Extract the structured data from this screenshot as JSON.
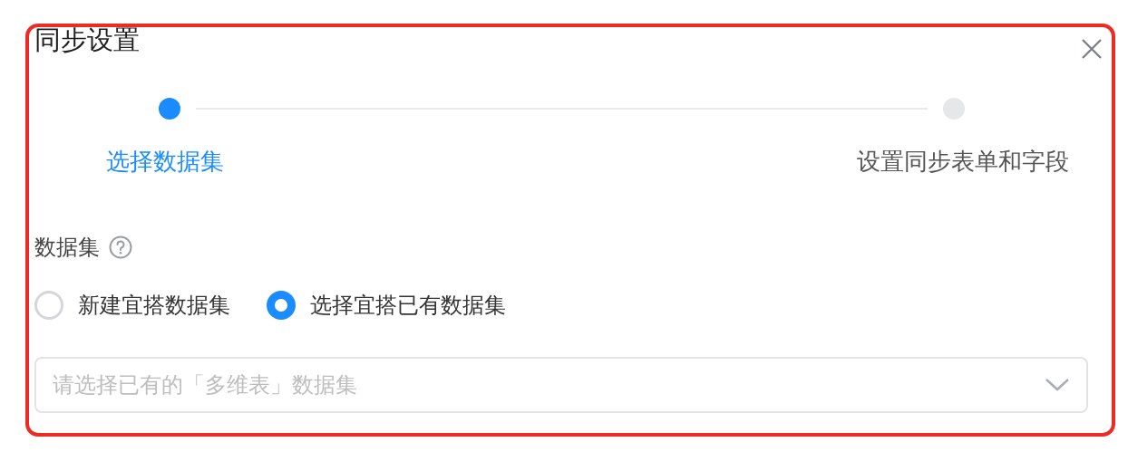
{
  "dialog": {
    "title": "同步设置"
  },
  "steps": [
    {
      "label": "选择数据集",
      "selected": true
    },
    {
      "label": "设置同步表单和字段",
      "selected": false
    }
  ],
  "field": {
    "label": "数据集"
  },
  "options": [
    {
      "label": "新建宜搭数据集",
      "selected": false
    },
    {
      "label": "选择宜搭已有数据集",
      "selected": true
    }
  ],
  "select": {
    "placeholder": "请选择已有的「多维表」数据集"
  }
}
